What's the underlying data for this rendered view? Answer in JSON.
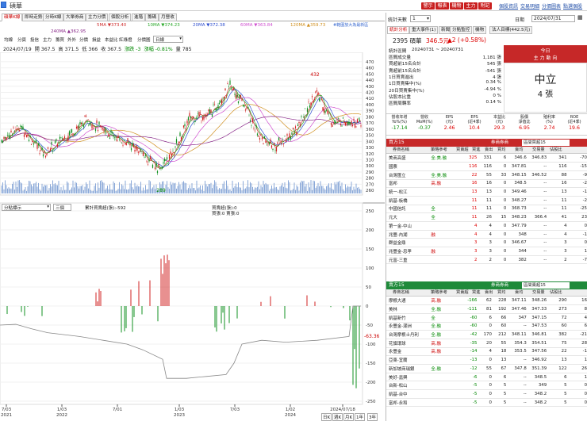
{
  "window": {
    "title": "碩華"
  },
  "top_buttons": [
    "警示",
    "報表",
    "機物",
    "主力",
    "附記"
  ],
  "top_links": [
    "個股資訊",
    "交易明細",
    "分價圖表",
    "點選個股"
  ],
  "main_tabs": [
    "碩華K線",
    "即時走勢",
    "分時K線",
    "大單券商",
    "主力分價",
    "個股分析",
    "進階",
    "籌碼",
    "月營收"
  ],
  "ma_legend": [
    "5MA ▼373.40",
    "10MA ▼374.23",
    "20MA ▼372.38",
    "60MA ▼363.84",
    "120MA ▲359.73",
    "240MA ▲362.95"
  ],
  "ma_colors": [
    "#d03030",
    "#2aa82a",
    "#3050d0",
    "#d050d0",
    "#d09020",
    "#8a2a8a"
  ],
  "range_label": "#範圍放大為最新區",
  "sub_tabs": [
    "均線",
    "分頁",
    "投信",
    "主力",
    "籌買",
    "外外",
    "分價",
    "損益",
    "本益比",
    "紅綠燈",
    "分價圖"
  ],
  "sub_select": "日線",
  "price_info": {
    "date": "2024/07/19",
    "open": "開 367.5",
    "high": "高 371.5",
    "low": "低 366",
    "close": "收 367.5",
    "chg": "漲跌 -3",
    "pct": "漲幅 -0.81%",
    "vol": "量 785"
  },
  "price_axis": [
    "470",
    "460",
    "450",
    "440",
    "430",
    "420",
    "410",
    "400",
    "390",
    "380",
    "370",
    "360",
    "350",
    "340",
    "330",
    "320",
    "310",
    "300",
    "290",
    "280",
    "270",
    "260"
  ],
  "peak_label": "432",
  "trough_label": "289",
  "ind_select": "分點標示",
  "ind_select2": "三個",
  "ind_legend": [
    "累計買賣超(張):-592",
    "買賣超(張):0",
    "買張:0  賣張:0"
  ],
  "ind_axis": [
    "250",
    "200",
    "150",
    "100",
    "50",
    "0",
    "-50",
    "-100",
    "-150",
    "-200",
    "-250"
  ],
  "ind_value": "-63.36",
  "x_labels": [
    "7/03",
    "1/03",
    "7/01",
    "1/03",
    "7/03",
    "1/02",
    "2024/07/18"
  ],
  "x_year": [
    "2021",
    "2022",
    "2023",
    "2024"
  ],
  "bottom_btns": [
    "日K",
    "週K",
    "月K",
    "1年",
    "3年"
  ],
  "chart_data": {
    "type": "candlestick",
    "ylim": [
      255,
      475
    ],
    "peak": 432,
    "trough": 289,
    "last_close": 367.5
  },
  "right": {
    "stat_days_label": "統計天數",
    "stat_days": "1",
    "date_label": "日期",
    "date": "2024/07/31",
    "tabs": [
      "統計分析",
      "重大事件(1)",
      "新聞",
      "分點監控",
      "機物",
      "法人目標(442.5元)"
    ],
    "stock": "2395 碩華",
    "price": "346.5元",
    "change": "▲2 (+0.58%)",
    "period_label": "統計區間",
    "period": "20240731 ~ 20240731",
    "lines": [
      {
        "l": "區間成交量",
        "v": "1,181 張"
      },
      {
        "l": "買超前15名合計",
        "v": "545 張"
      },
      {
        "l": "賣超前15名合計",
        "v": "-541 張"
      },
      {
        "l": "1日買賣進出",
        "v": "4 張"
      },
      {
        "l": "1日買賣集中(%)",
        "v": "0.34 %"
      },
      {
        "l": "20日買賣集中(%)",
        "v": "-4.94 %"
      },
      {
        "l": "佔股本比重",
        "v": "0 %"
      },
      {
        "l": "區間周轉率",
        "v": "0.14 %"
      }
    ],
    "today_label": "今日",
    "main_label": "主 力 動 向",
    "status": "中立",
    "status_val": "4 張",
    "metrics": [
      [
        "營收年增",
        "Yo%(%)",
        "-17.14"
      ],
      [
        "營收",
        "MoM(%)",
        "-0.37"
      ],
      [
        "EPS",
        "(元)",
        "2.46"
      ],
      [
        "EPS",
        "(近4季)",
        "10.4"
      ],
      [
        "本益比",
        "(元)",
        "29.3"
      ],
      [
        "股價",
        "淨值比",
        "6.95"
      ],
      [
        "殖利率",
        "(%)",
        "2.74"
      ],
      [
        "ROE",
        "(近4季)",
        "19.6"
      ]
    ],
    "buy": {
      "title": "買方15",
      "label": "券商券商",
      "select": "區間買超15",
      "cols": [
        "券商名稱",
        "策略參考",
        "買賣超",
        "買進",
        "賣出",
        "買均",
        "賣均",
        "交易量",
        "佔股比"
      ],
      "rows": [
        [
          "美商高盛",
          "全.美.融",
          "325",
          "331",
          "6",
          "346.6",
          "346.83",
          "341",
          "-70"
        ],
        [
          "國票",
          "",
          "116",
          "116",
          "0",
          "347.81",
          "--",
          "116",
          "-15"
        ],
        [
          "台灣匯立",
          "全.美.融",
          "22",
          "55",
          "33",
          "348.15",
          "346.52",
          "88",
          "-9"
        ],
        [
          "富邦",
          "高.融",
          "16",
          "16",
          "0",
          "348.5",
          "--",
          "16",
          "-2"
        ],
        [
          "統一-松江",
          "",
          "13",
          "13",
          "0",
          "349.46",
          "--",
          "13",
          "-1"
        ],
        [
          "凱基-板橋",
          "",
          "11",
          "11",
          "0",
          "348.27",
          "--",
          "11",
          "-2"
        ],
        [
          "中國信託",
          "全",
          "11",
          "11",
          "0",
          "368.73",
          "--",
          "11",
          "-25"
        ],
        [
          "元大",
          "全",
          "11",
          "26",
          "15",
          "348.23",
          "366.4",
          "41",
          "23"
        ],
        [
          "第一金-中山",
          "",
          "4",
          "4",
          "0",
          "347.79",
          "--",
          "4",
          "0"
        ],
        [
          "兆豐-內湖",
          "融",
          "4",
          "4",
          "0",
          "348",
          "--",
          "4",
          "-1"
        ],
        [
          "群益金鼎",
          "",
          "3",
          "3",
          "0",
          "346.67",
          "--",
          "3",
          "0"
        ],
        [
          "兆豐金-忠孝",
          "融",
          "3",
          "3",
          "0",
          "344",
          "--",
          "3",
          "1"
        ],
        [
          "元富-三重",
          "",
          "2",
          "2",
          "0",
          "382",
          "--",
          "2",
          "-7"
        ]
      ]
    },
    "sell": {
      "title": "賣方15",
      "select": "區間賣超15",
      "cols": [
        "券商名稱",
        "策略參考",
        "買賣超",
        "買進",
        "賣出",
        "買均",
        "賣均",
        "交易量",
        "佔股比"
      ],
      "rows": [
        [
          "摩根大通",
          "高.融",
          "-166",
          "62",
          "228",
          "347.11",
          "348.26",
          "290",
          "16"
        ],
        [
          "美林",
          "全.融",
          "-111",
          "81",
          "192",
          "347.46",
          "347.33",
          "273",
          "8"
        ],
        [
          "凱基新竹",
          "全",
          "-60",
          "6",
          "66",
          "347",
          "347.15",
          "72",
          "4"
        ],
        [
          "永豐金-潮洲",
          "全.融",
          "-60",
          "0",
          "60",
          "--",
          "347.53",
          "60",
          "6"
        ],
        [
          "台灣摩根士丹利",
          "全.融",
          "-42",
          "170",
          "212",
          "348.11",
          "346.81",
          "382",
          "-21"
        ],
        [
          "花旗環球",
          "高.融",
          "-35",
          "20",
          "55",
          "354.3",
          "354.51",
          "75",
          "28"
        ],
        [
          "永豐金",
          "高.融",
          "-14",
          "4",
          "18",
          "353.5",
          "347.56",
          "22",
          "-1"
        ],
        [
          "亞東-宜蘭",
          "",
          "-13",
          "0",
          "13",
          "--",
          "346.92",
          "13",
          "1"
        ],
        [
          "新加坡商瑞銀",
          "全.融",
          "-12",
          "55",
          "67",
          "347.8",
          "351.39",
          "122",
          "26"
        ],
        [
          "美好-嘉興",
          "",
          "-6",
          "0",
          "6",
          "--",
          "348.5",
          "6",
          "1"
        ],
        [
          "台新-松山",
          "",
          "-5",
          "0",
          "5",
          "--",
          "349",
          "5",
          "0"
        ],
        [
          "凱基-台中",
          "",
          "-5",
          "0",
          "5",
          "--",
          "348.2",
          "5",
          "0"
        ],
        [
          "富邦-永和",
          "",
          "-5",
          "0",
          "5",
          "--",
          "348.2",
          "5",
          "0"
        ]
      ]
    }
  }
}
